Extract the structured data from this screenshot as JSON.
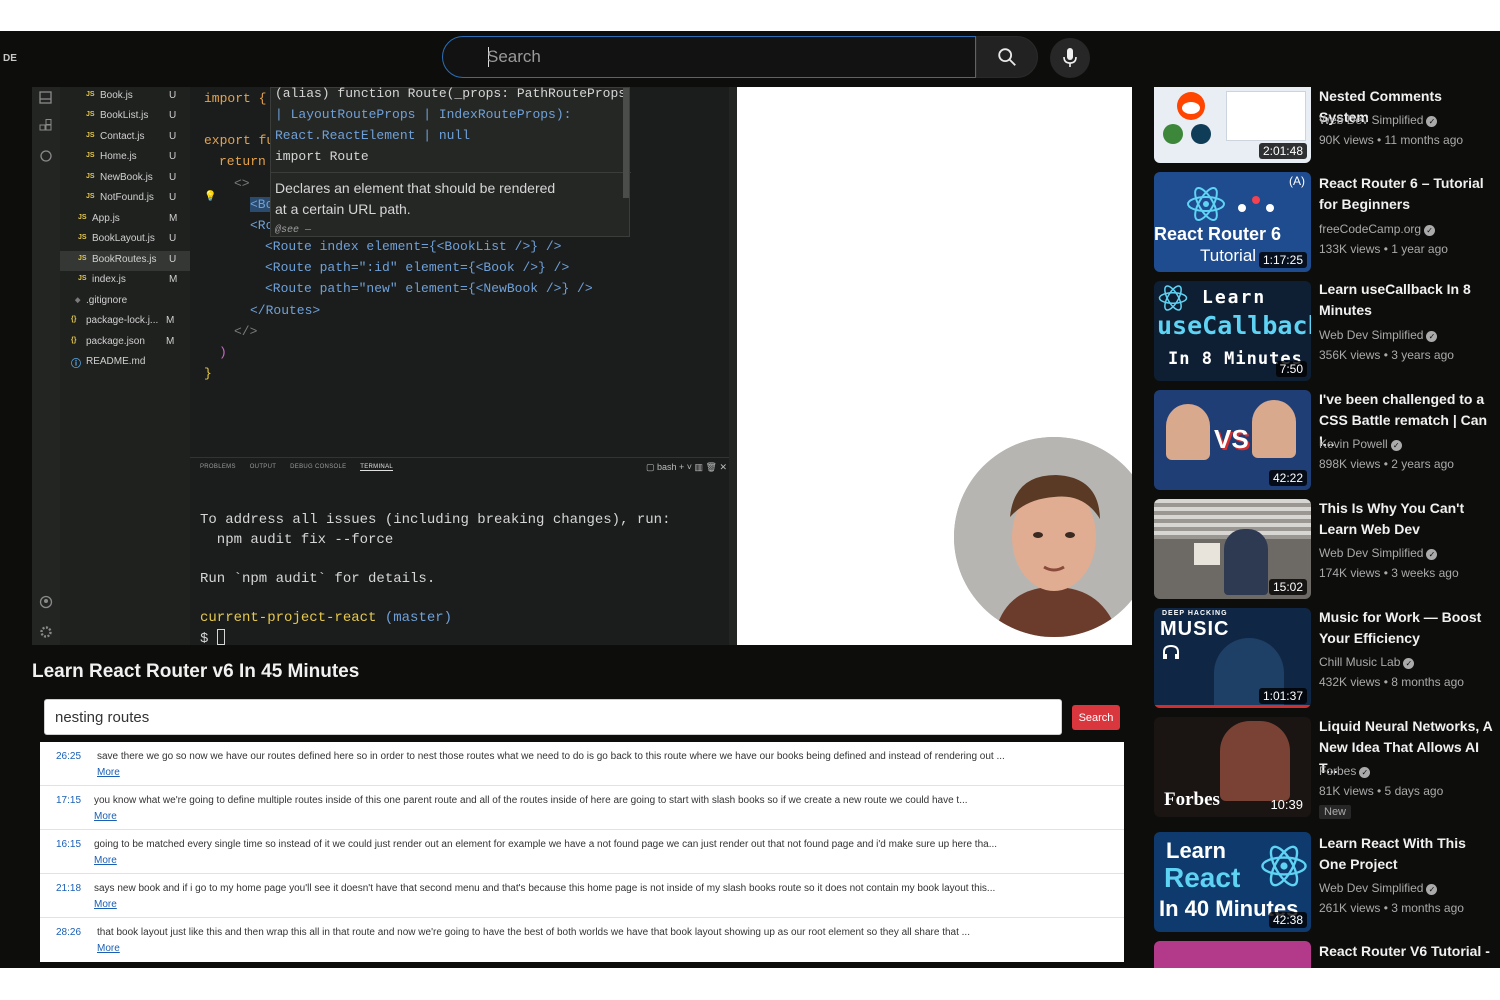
{
  "topbar": {
    "edge_label": "DE",
    "search_placeholder": "Search"
  },
  "explorer": {
    "files": [
      {
        "name": "Book.js",
        "icon": "JS",
        "status": "U"
      },
      {
        "name": "BookList.js",
        "icon": "JS",
        "status": "U"
      },
      {
        "name": "Contact.js",
        "icon": "JS",
        "status": "U"
      },
      {
        "name": "Home.js",
        "icon": "JS",
        "status": "U"
      },
      {
        "name": "NewBook.js",
        "icon": "JS",
        "status": "U"
      },
      {
        "name": "NotFound.js",
        "icon": "JS",
        "status": "U"
      },
      {
        "name": "App.js",
        "icon": "JS",
        "status": "M"
      },
      {
        "name": "BookLayout.js",
        "icon": "JS",
        "status": "U"
      },
      {
        "name": "BookRoutes.js",
        "icon": "JS",
        "status": "U"
      },
      {
        "name": "index.js",
        "icon": "JS",
        "status": "M"
      },
      {
        "name": ".gitignore",
        "icon": "◆",
        "status": ""
      },
      {
        "name": "package-lock.j...",
        "icon": "{}",
        "status": "M"
      },
      {
        "name": "package.json",
        "icon": "{}",
        "status": "M"
      },
      {
        "name": "README.md",
        "icon": "ⓘ",
        "status": ""
      }
    ]
  },
  "editor": {
    "tooltip": {
      "line1": "(alias) function Route(_props: PathRouteProps",
      "line2": "| LayoutRouteProps | IndexRouteProps):",
      "line3": "React.ReactElement | null",
      "line4": "import Route",
      "doc1": "Declares an element that should be rendered",
      "doc2": "at a certain URL path.",
      "see": "@see —"
    },
    "lines": {
      "l1": "import {",
      "l2": "export fu",
      "l3": "return",
      "l4": "<>",
      "l5": "<Bo",
      "l6": "<Ro",
      "l7": "<Route index element={<BookList />} />",
      "l8": "<Route path=\":id\" element={<Book />} />",
      "l9": "<Route path=\"new\" element={<NewBook />} />",
      "l10": "</Routes>",
      "l11": "</>",
      "l12": ")",
      "l13": "}"
    }
  },
  "panel": {
    "tabs": [
      "PROBLEMS",
      "OUTPUT",
      "DEBUG CONSOLE",
      "TERMINAL"
    ],
    "tools": "▢ bash  + ˅  ▥  🗑  ✕",
    "term1": "To address all issues (including breaking changes), run:",
    "term2": "  npm audit fix --force",
    "term3": "Run `npm audit` for details.",
    "prompt_dir": "current-project-react",
    "prompt_branch": "(master)",
    "prompt": "$"
  },
  "video_title": "Learn React Router v6 In 45 Minutes",
  "transcript": {
    "query": "nesting routes",
    "button": "Search",
    "more_label": "More",
    "results": [
      {
        "time": "26:25",
        "text": "save there we go so now we have our routes defined here so in order to nest those routes what we need to do is go back to this route where we have our books being defined and instead of rendering out ..."
      },
      {
        "time": "17:15",
        "text": "you know what we're going to define multiple routes inside of this one parent route and all of the routes inside of here are going to start with slash books so if we create a new route we could have t..."
      },
      {
        "time": "16:15",
        "text": "going to be matched every single time so instead of it we could just render out an element for example we have a not found page we can just render out that not found page and i'd make sure up here tha..."
      },
      {
        "time": "21:18",
        "text": "says new book and if i go to my home page you'll see it doesn't have that second menu and that's because this home page is not inside of my slash books route so it does not contain my book layout this..."
      },
      {
        "time": "28:26",
        "text": "that book layout just like this and then wrap this all in that route and now we're going to have the best of both worlds we have that book layout showing up as our root element so they all share that ..."
      }
    ]
  },
  "sidebar": {
    "videos": [
      {
        "title": "Nested Comments System",
        "channel": "Web Dev Simplified",
        "verified": true,
        "meta": "90K views • 11 months ago",
        "duration": "2:01:48",
        "thumb_bg": "#e9eef4",
        "thumb_text": ""
      },
      {
        "title": "React Router 6 – Tutorial for Beginners",
        "channel": "freeCodeCamp.org",
        "verified": true,
        "meta": "133K views • 1 year ago",
        "duration": "1:17:25",
        "thumb_bg": "#1e4c8f",
        "thumb_text": "React Router 6",
        "thumb_sub": "Tutorial",
        "corner": "(A)"
      },
      {
        "title": "Learn useCallback In 8 Minutes",
        "channel": "Web Dev Simplified",
        "verified": true,
        "meta": "356K views • 3 years ago",
        "duration": "7:50",
        "thumb_bg": "#0f1f33",
        "thumb_text": "Learn",
        "thumb_big": "useCallback",
        "thumb_sub": "In 8 Minutes"
      },
      {
        "title": "I've been challenged to a CSS Battle rematch | Can I...",
        "channel": "Kevin Powell",
        "verified": true,
        "meta": "898K views • 2 years ago",
        "duration": "42:22",
        "thumb_bg": "#1f3e75",
        "thumb_text": "VS"
      },
      {
        "title": "This Is Why You Can't Learn Web Dev",
        "channel": "Web Dev Simplified",
        "verified": true,
        "meta": "174K views • 3 weeks ago",
        "duration": "15:02",
        "thumb_bg": "#6d6a66",
        "thumb_text": ""
      },
      {
        "title": "Music for Work — Boost Your Efficiency",
        "channel": "Chill Music Lab",
        "verified": true,
        "meta": "432K views • 8 months ago",
        "duration": "1:01:37",
        "thumb_bg": "#0f2744",
        "thumb_text": "MUSIC",
        "thumb_small": "DEEP HACKING"
      },
      {
        "title": "Liquid Neural Networks, A New Idea That Allows AI T...",
        "channel": "Forbes",
        "verified": true,
        "meta": "81K views • 5 days ago",
        "duration": "10:39",
        "thumb_bg": "#1a1412",
        "thumb_text": "Forbes",
        "badge": "New"
      },
      {
        "title": "Learn React With This One Project",
        "channel": "Web Dev Simplified",
        "verified": true,
        "meta": "261K views • 3 months ago",
        "duration": "42:38",
        "thumb_bg": "#0f3a6e",
        "thumb_text": "Learn",
        "thumb_big": "React",
        "thumb_sub": "In 40 Minutes"
      },
      {
        "title": "React Router V6 Tutorial -",
        "channel": "",
        "verified": false,
        "meta": "",
        "duration": "",
        "thumb_bg": "#b33a8a",
        "thumb_text": ""
      }
    ]
  }
}
